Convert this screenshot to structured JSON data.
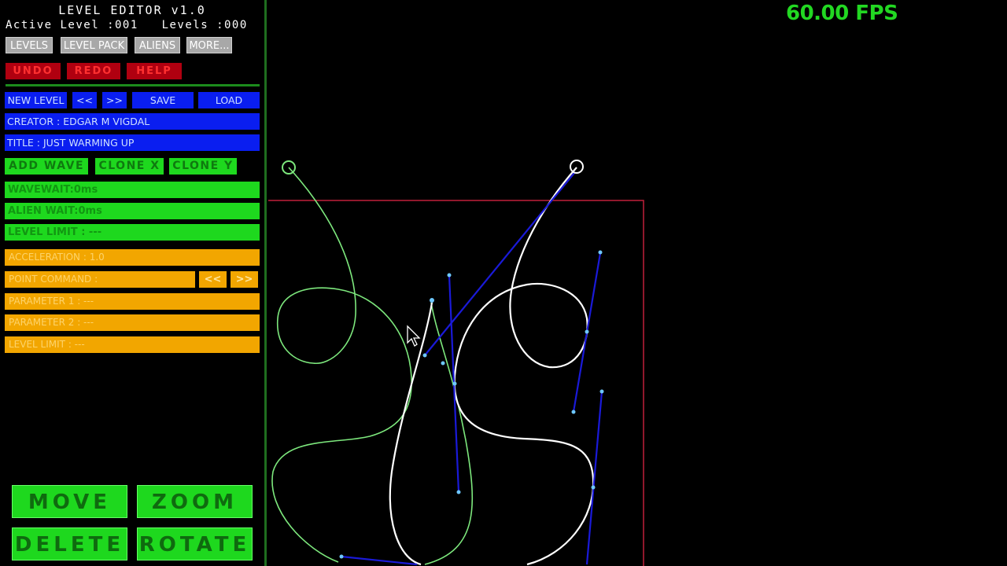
{
  "header": {
    "title": "LEVEL EDITOR v1.0",
    "status": "Active Level :001   Levels :000"
  },
  "top_menu": [
    "LEVELS",
    "LEVEL PACK",
    "ALIENS",
    "MORE..."
  ],
  "edit_actions": [
    "UNDO",
    "REDO",
    "HELP"
  ],
  "level_toolbar": {
    "new_level": "NEW LEVEL",
    "prev": "<<",
    "next": ">>",
    "save": "SAVE",
    "load": "LOAD"
  },
  "level_info": {
    "creator": "CREATOR : EDGAR M VIGDAL",
    "title": "TITLE : JUST WARMING UP"
  },
  "wave_buttons": [
    "ADD WAVE",
    "CLONE X",
    "CLONE Y"
  ],
  "wave_fields": [
    "WAVEWAIT:0ms",
    "ALIEN WAIT:0ms",
    "LEVEL LIMIT : ---"
  ],
  "point_fields": {
    "acceleration": "ACCELERATION : 1.0",
    "point_command": "POINT COMMAND :",
    "prev": "<<",
    "next": ">>",
    "parameter1": "PARAMETER 1 : ---",
    "parameter2": "PARAMETER 2 : ---",
    "level_limit": "LEVEL LIMIT : ---"
  },
  "tools": [
    "MOVE",
    "ZOOM",
    "DELETE",
    "ROTATE"
  ],
  "fps": "60.00 FPS",
  "colors": {
    "grey_button": "#a8a8a8",
    "red_button": "#b00010",
    "blue_field": "#0a1ef0",
    "green_field": "#1ed81e",
    "orange_field": "#f2a600",
    "green_path": "#7de87d",
    "white_path": "#ffffff",
    "control_handle": "#1a1ad8",
    "bounds_frame": "#c0203a",
    "fps_text": "#22d822"
  }
}
